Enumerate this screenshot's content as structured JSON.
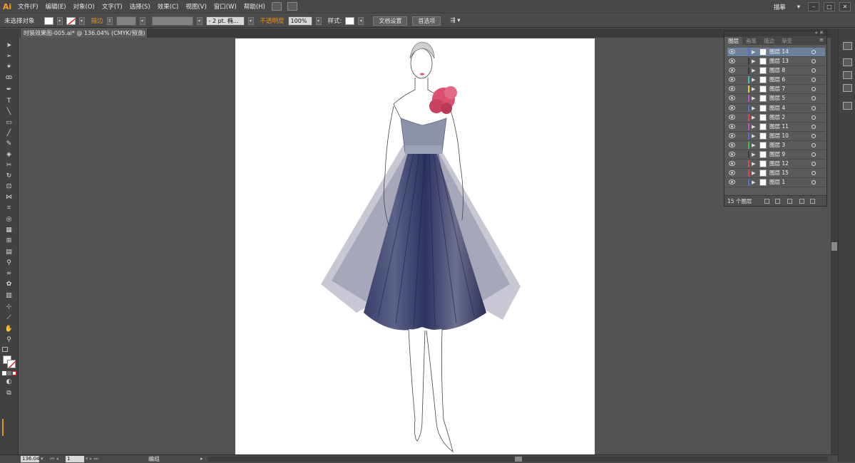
{
  "app": {
    "logo": "Ai",
    "menu": [
      "文件(F)",
      "编辑(E)",
      "对象(O)",
      "文字(T)",
      "选择(S)",
      "效果(C)",
      "视图(V)",
      "窗口(W)",
      "帮助(H)"
    ],
    "workspace_label": "描摹"
  },
  "controlbar": {
    "selection_label": "未选择对象",
    "stroke_label": "描边",
    "stroke_weight": "- 2 pt. 椭...",
    "opacity_label": "不透明度",
    "opacity_value": "100%",
    "style_label": "样式:",
    "doc_setup": "文档设置",
    "preferences": "首选项"
  },
  "document": {
    "tab_title": "时装效果图-005.ai* @ 136.04% (CMYK/预览)",
    "tab_close": "×"
  },
  "status": {
    "zoom": "136.04",
    "page": "1",
    "mode": "编组"
  },
  "layers_panel": {
    "tabs": [
      "图层",
      "画笔",
      "描边",
      "渐变"
    ],
    "active_tab": "图层",
    "layers": [
      {
        "name": "图层 14",
        "color": "#4f6fd6"
      },
      {
        "name": "图层 13",
        "color": "#3a3a3a"
      },
      {
        "name": "图层 8",
        "color": "#3a3a3a"
      },
      {
        "name": "图层 6",
        "color": "#3cc0c0"
      },
      {
        "name": "图层 7",
        "color": "#e2d23a"
      },
      {
        "name": "图层 5",
        "color": "#c24cc8"
      },
      {
        "name": "图层 4",
        "color": "#4f6fd6"
      },
      {
        "name": "图层 2",
        "color": "#d84a4a"
      },
      {
        "name": "图层 11",
        "color": "#c24cc8"
      },
      {
        "name": "图层 10",
        "color": "#4f6fd6"
      },
      {
        "name": "图层 3",
        "color": "#3cc04a"
      },
      {
        "name": "图层 9",
        "color": "#3a3a3a"
      },
      {
        "name": "图层 12",
        "color": "#d84a4a"
      },
      {
        "name": "图层 15",
        "color": "#d84a4a"
      },
      {
        "name": "图层 1",
        "color": "#4f6fd6"
      }
    ],
    "footer": "15 个图层"
  },
  "colors": {
    "dress_navy": "#2f3560",
    "dress_tulle": "#9a9bb0",
    "bodice": "#8c93a8",
    "flower": "#d9516f"
  }
}
